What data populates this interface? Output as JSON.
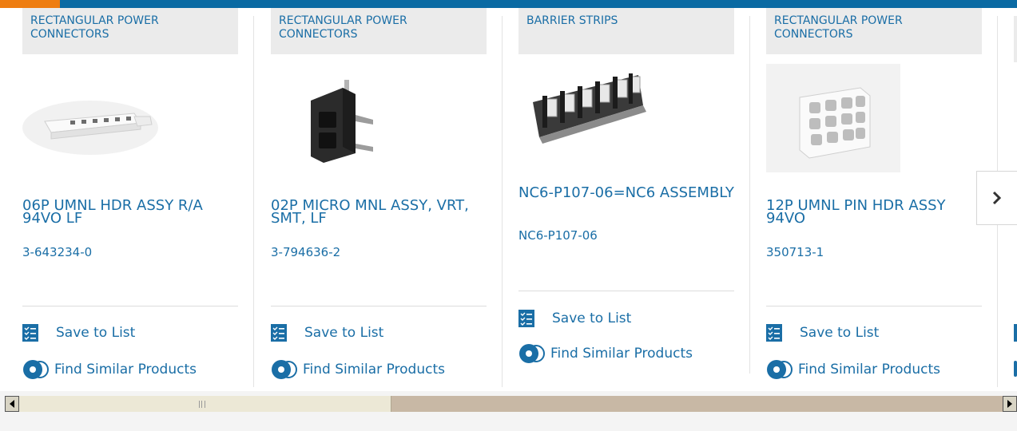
{
  "cards": [
    {
      "category": "RECTANGULAR POWER CONNECTORS",
      "title": "06P UMNL HDR ASSY R/A 94VO LF",
      "part_number": "3-643234-0",
      "save_label": "Save to List",
      "similar_label": "Find Similar Products"
    },
    {
      "category": "RECTANGULAR POWER CONNECTORS",
      "title": "02P MICRO MNL ASSY, VRT, SMT, LF",
      "part_number": "3-794636-2",
      "save_label": "Save to List",
      "similar_label": "Find Similar Products"
    },
    {
      "category": "BARRIER STRIPS",
      "title": "NC6-P107-06=NC6 ASSEMBLY",
      "part_number": "NC6-P107-06",
      "save_label": "Save to List",
      "similar_label": "Find Similar Products"
    },
    {
      "category": "RECTANGULAR POWER CONNECTORS",
      "title": "12P UMNL PIN HDR ASSY 94VO",
      "part_number": "350713-1",
      "save_label": "Save to List",
      "similar_label": "Find Similar Products"
    }
  ],
  "carousel": {
    "next_icon": "chevron-right-icon"
  },
  "colors": {
    "brand_blue": "#1a6ea6",
    "bar_blue": "#0a6aa3",
    "accent_orange": "#ee7d11"
  }
}
